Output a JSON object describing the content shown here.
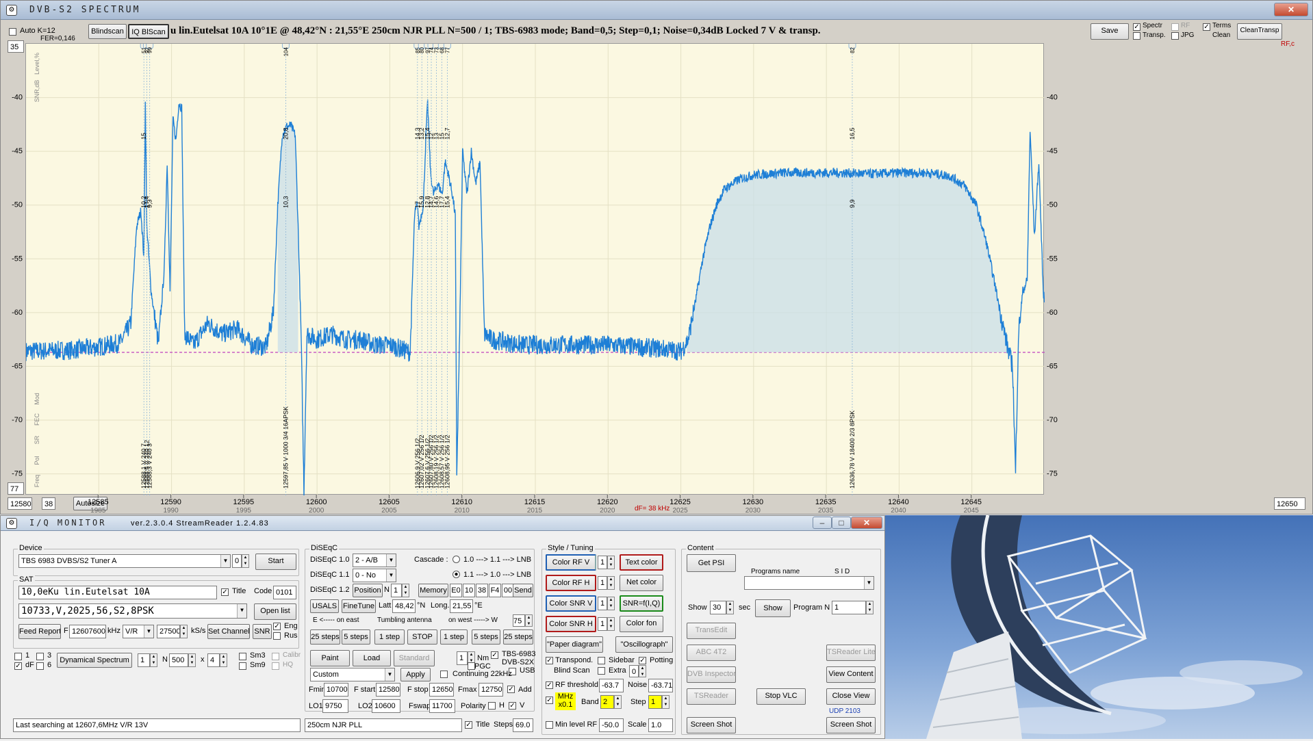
{
  "spectrum_window": {
    "title": "DVB-S2  SPECTRUM",
    "auto_k": "Auto  K=12",
    "fer": "FER=0,146",
    "blindscan": "Blindscan",
    "iq_blscan": "IQ BlScan",
    "info": "u lin.Eutelsat 10A    10°1E  @  48,42°N : 21,55°E     250cm NJR PLL     N=500 / 1; TBS-6983 mode; Band=0,5; Step=0,1; Noise=0,34dB     Locked  7 V  & transp.",
    "save": "Save",
    "opt_spectr": "Spectr",
    "opt_transp": "Transp.",
    "opt_rf": "RF",
    "opt_jpg": "JPG",
    "opt_terms": "Terms",
    "opt_clean": "Clean",
    "clean_transp": "CleanTransp",
    "top_val": "35",
    "bottom_val": "77",
    "fstart": "12580",
    "step_val": "38",
    "autosize": "Autosize",
    "fend": "12650",
    "df": "dF= 38 kHz",
    "rf_c": "RF,c",
    "left_labels": [
      "Level,%",
      "SNR,dB"
    ],
    "left_labels_bottom": [
      "Freq",
      "Pol",
      "SR",
      "FEC",
      "Mod"
    ]
  },
  "chart_data": {
    "type": "line",
    "xlim": [
      12580,
      12650
    ],
    "ylim": [
      -77,
      -35
    ],
    "x_ticks": [
      12585,
      12590,
      12595,
      12600,
      12605,
      12610,
      12615,
      12620,
      12625,
      12630,
      12635,
      12640,
      12645
    ],
    "x_ticks_if": [
      1985,
      1990,
      1995,
      2000,
      2005,
      2010,
      2015,
      2020,
      2025,
      2030,
      2035,
      2040,
      2045
    ],
    "y_ticks": [
      -40,
      -45,
      -50,
      -55,
      -60,
      -65,
      -70,
      -75
    ],
    "noise_floor": -63.7,
    "spectrum": [
      [
        12580,
        -63.6
      ],
      [
        12583,
        -63.5
      ],
      [
        12585,
        -63.2
      ],
      [
        12586.5,
        -62.8
      ],
      [
        12587.2,
        -61
      ],
      [
        12587.6,
        -52
      ],
      [
        12587.9,
        -50.5
      ],
      [
        12588.1,
        -55
      ],
      [
        12588.2,
        -40.5
      ],
      [
        12588.3,
        -52
      ],
      [
        12588.6,
        -58
      ],
      [
        12588.9,
        -61
      ],
      [
        12589.1,
        -63
      ],
      [
        12589.5,
        -56
      ],
      [
        12589.7,
        -46
      ],
      [
        12589.9,
        -58
      ],
      [
        12590.1,
        -42
      ],
      [
        12590.3,
        -44
      ],
      [
        12590.5,
        -40.5
      ],
      [
        12590.7,
        -41
      ],
      [
        12590.9,
        -62
      ],
      [
        12591.5,
        -63
      ],
      [
        12592.5,
        -61
      ],
      [
        12593.5,
        -62
      ],
      [
        12594.5,
        -61.5
      ],
      [
        12595.5,
        -63
      ],
      [
        12596.5,
        -63.2
      ],
      [
        12597.0,
        -60
      ],
      [
        12597.3,
        -50
      ],
      [
        12597.6,
        -43.5
      ],
      [
        12597.9,
        -42.7
      ],
      [
        12598.2,
        -42.6
      ],
      [
        12598.5,
        -43.5
      ],
      [
        12598.7,
        -52
      ],
      [
        12598.9,
        -62
      ],
      [
        12599.1,
        -76.5
      ],
      [
        12599.3,
        -62
      ],
      [
        12600,
        -62.5
      ],
      [
        12601,
        -62
      ],
      [
        12602,
        -62.5
      ],
      [
        12603,
        -62.5
      ],
      [
        12604,
        -63
      ],
      [
        12605,
        -63
      ],
      [
        12606,
        -63.5
      ],
      [
        12606.4,
        -63.7
      ],
      [
        12606.7,
        -51
      ],
      [
        12606.9,
        -49.8
      ],
      [
        12607.0,
        -52
      ],
      [
        12607.3,
        -50
      ],
      [
        12607.5,
        -43
      ],
      [
        12607.6,
        -40.5
      ],
      [
        12607.8,
        -47
      ],
      [
        12608.0,
        -49
      ],
      [
        12608.3,
        -48
      ],
      [
        12608.6,
        -49
      ],
      [
        12608.8,
        -46
      ],
      [
        12609.0,
        -47
      ],
      [
        12609.3,
        -49
      ],
      [
        12609.5,
        -51
      ],
      [
        12609.6,
        -75
      ],
      [
        12609.8,
        -62
      ],
      [
        12610.0,
        -45
      ],
      [
        12610.3,
        -49
      ],
      [
        12610.6,
        -45
      ],
      [
        12610.9,
        -48
      ],
      [
        12611.2,
        -46
      ],
      [
        12611.5,
        -62
      ],
      [
        12612,
        -62.5
      ],
      [
        12614,
        -63
      ],
      [
        12616,
        -63
      ],
      [
        12618,
        -63
      ],
      [
        12620,
        -63
      ],
      [
        12622,
        -63.2
      ],
      [
        12624,
        -63.4
      ],
      [
        12625,
        -63.6
      ],
      [
        12625.5,
        -62.5
      ],
      [
        12626,
        -59
      ],
      [
        12626.5,
        -55
      ],
      [
        12627,
        -52
      ],
      [
        12627.5,
        -49.8
      ],
      [
        12628,
        -48.5
      ],
      [
        12629,
        -47.6
      ],
      [
        12630,
        -47.2
      ],
      [
        12632,
        -47.0
      ],
      [
        12634,
        -47.0
      ],
      [
        12636,
        -47.0
      ],
      [
        12638,
        -47.1
      ],
      [
        12640,
        -47.0
      ],
      [
        12642,
        -47.0
      ],
      [
        12643.5,
        -47.3
      ],
      [
        12644.5,
        -48.2
      ],
      [
        12645.3,
        -50
      ],
      [
        12646,
        -53.5
      ],
      [
        12646.6,
        -57.5
      ],
      [
        12647.1,
        -61
      ],
      [
        12647.5,
        -63.5
      ],
      [
        12647.8,
        -65
      ],
      [
        12648.0,
        -75
      ],
      [
        12648.2,
        -62
      ],
      [
        12648.5,
        -58
      ],
      [
        12648.8,
        -57
      ],
      [
        12649.0,
        -43
      ],
      [
        12649.3,
        -53
      ],
      [
        12649.6,
        -46
      ],
      [
        12649.9,
        -58
      ],
      [
        12650,
        -59
      ]
    ],
    "markers": [
      {
        "id": "51",
        "freq": 12588.1,
        "snr": "10,2",
        "lvl": "15",
        "label": "12588,1 V 240 7"
      },
      {
        "id": "93",
        "freq": 12588.3,
        "snr": "17,4",
        "label": "12588,5 V 240 12"
      },
      {
        "id": "99",
        "freq": 12588.5,
        "snr": "9,3",
        "label": "12588,3 V 240 3"
      },
      {
        "id": "104",
        "freq": 12597.85,
        "snr": "10,3",
        "lvl": "20,8",
        "label": "12597,85 V 1000 3/4 16APSK"
      },
      {
        "id": "85",
        "freq": 12606.9,
        "snr": "17",
        "lvl": "14,3",
        "label": "12606,9 V 256 1/2"
      },
      {
        "id": "80",
        "freq": 12607.2,
        "snr": "15,9",
        "lvl": "13,2",
        "label": "12607,02 V 256 1/2"
      },
      {
        "id": "97",
        "freq": 12607.6,
        "snr": "12,8",
        "lvl": "15,4",
        "label": "12607,6 V 256 1/2"
      },
      {
        "id": "74",
        "freq": 12607.85,
        "snr": "14,7",
        "lvl": "12",
        "label": "12607,80 V 256 1/2"
      },
      {
        "id": "73",
        "freq": 12608.2,
        "snr": "14,6",
        "lvl": "13",
        "label": "12608,19 V 256 1/2"
      },
      {
        "id": "68",
        "freq": 12608.57,
        "snr": "17,7",
        "lvl": "15",
        "label": "12608,57 V 256 1/2"
      },
      {
        "id": "77",
        "freq": 12608.95,
        "snr": "15,4",
        "lvl": "12,7",
        "label": "12608,95 V 256 1/2"
      },
      {
        "id": "82",
        "freq": 12636.78,
        "snr": "9,9",
        "lvl": "16,5",
        "label": "12636,78 V 18400 2/3 8PSK"
      }
    ]
  },
  "iq_window": {
    "title": "I/Q  MONITOR",
    "version": "ver.2.3.0.4  StreamReader 1.2.4.83",
    "device_label": "Device",
    "device": "TBS 6983 DVBS/S2 Tuner A",
    "device_num": "0",
    "start": "Start",
    "sat_label": "SAT",
    "sat_name": "10,0eKu lin.Eutelsat 10A",
    "title_cb": "Title",
    "code_label": "Code",
    "code": "0101",
    "transponder": "10733,V,2025,56,S2,8PSK",
    "open_list": "Open list",
    "feed_report": "Feed Report",
    "f_label": "F",
    "freq": "12607600",
    "khz": "kHz",
    "pol": "V/R",
    "sr": "27500",
    "ksps": "kS/s",
    "set_channel": "Set Channel",
    "snr": "SNR",
    "eng": "Eng",
    "rus": "Rus",
    "cb1": "1",
    "cb3": "3",
    "cbdf": "dF",
    "cb6": "6",
    "dyn_spec": "Dynamical Spectrum",
    "n1": "1",
    "n_label": "N",
    "n500": "500",
    "x_label": "x",
    "x4": "4",
    "sm3": "Sm3",
    "sm9": "Sm9",
    "calibr": "Calibr",
    "hq": "HQ",
    "status": "Last searching at 12607,6MHz  V/R  13V",
    "diseqc_label": "DiSEqC",
    "d10": "DiSEqC 1.0",
    "d10v": "2 - A/B",
    "d11": "DiSEqC 1.1",
    "d11v": "0 - No",
    "cascade": "Cascade :",
    "casc1": "1.0 ---> 1.1 ---> LNB",
    "casc2": "1.1 ---> 1.0 ---> LNB",
    "d12": "DiSEqC 1.2",
    "position": "Position",
    "n_short": "N",
    "pos_n": "1",
    "memory": "Memory",
    "mem_vals": [
      "E0",
      "10",
      "38",
      "F4",
      "00"
    ],
    "send": "Send",
    "usals": "USALS",
    "finetune": "FineTune",
    "latt": "Latt",
    "latt_v": "48,42",
    "north": "°N",
    "long": "Long.",
    "long_v": "21,55",
    "east_deg": "°E",
    "east_arrow": "E  <-----  on   east",
    "tumbling": "Tumbling antenna",
    "west_arrow": "on   west  -----> W",
    "w_v": "75",
    "s25a": "25 steps",
    "s5a": "5 steps",
    "s1a": "1 step",
    "stop": "STOP",
    "s1b": "1 step",
    "s5b": "5 steps",
    "s25b": "25 steps",
    "paint": "Paint",
    "load": "Load",
    "standard": "Standard",
    "nm_v": "1",
    "nm": "Nm",
    "pgc": "PGC",
    "tbs6983": "TBS-6983",
    "dvbs2x": "DVB-S2X",
    "usb": "USB",
    "custom": "Custom",
    "apply": "Apply",
    "continuing": "Continuing 22kHz",
    "fmin": "Fmin",
    "fmin_v": "10700",
    "fstart_l": "F start",
    "fstart_v": "12580",
    "fstop_l": "F stop",
    "fstop_v": "12650",
    "fmax": "Fmax",
    "fmax_v": "12750",
    "add": "Add",
    "lo1": "LO1",
    "lo1_v": "9750",
    "lo2": "LO2",
    "lo2_v": "10600",
    "fswap": "Fswap",
    "fswap_v": "11700",
    "polarity": "Polarity",
    "pol_h": "H",
    "pol_v": "V",
    "antenna": "250cm NJR PLL",
    "title_cb2": "Title",
    "steps_l": "Steps",
    "steps_v": "69.0",
    "style_label": "Style / Tuning",
    "c_rfv": "Color  RF  V",
    "c_rfh": "Color  RF  H",
    "c_snrv": "Color  SNR V",
    "c_snrh": "Color  SNR H",
    "text_color": "Text color",
    "net_color": "Net color",
    "snr_fiq": "SNR=f(I,Q)",
    "color_fon": "Color fon",
    "paper_diag": "\"Paper diagram\"",
    "oscillo": "\"Oscillograph\"",
    "transpond": "Transpond.",
    "sidebar": "Sidebar",
    "potting": "Potting",
    "blind_scan": "Blind  Scan",
    "extra": "Extra",
    "extra_v": "0",
    "rf_thr": "RF threshold",
    "rf_thr_v": "-63.7",
    "noise_l": "Noise",
    "noise_v": "-63.71",
    "mhz": "MHz",
    "x01": "x0.1",
    "band": "Band",
    "band_v": "2",
    "step_l": "Step",
    "step_v2": "1",
    "min_level": "Min level RF",
    "min_level_v": "-50.0",
    "scale": "Scale",
    "scale_v": "1.0",
    "content_label": "Content",
    "get_psi": "Get  PSI",
    "programs_name": "Programs  name",
    "sid": "S I D",
    "show_l": "Show",
    "show_v": "30",
    "sec": "sec",
    "show_btn": "Show",
    "program_n": "Program  N",
    "prog_v": "1",
    "transedit": "TransEdit",
    "abc4t2": "ABC 4T2",
    "tsreader_lite": "TSReader Lite",
    "dvb_inspector": "DVB Inspector",
    "view_content": "View Content",
    "tsreader": "TSReader",
    "stop_vlc": "Stop  VLC",
    "close_view": "Close View",
    "udp": "UDP 2103",
    "screen_shot1": "Screen Shot",
    "screen_shot2": "Screen Shot"
  },
  "colors": {
    "spectrum": "#1e7fd6",
    "fill": "#c9dfe8",
    "plot_bg": "#fbf8e1",
    "noise": "#c040c0",
    "accent_yellow": "#ffff00"
  }
}
